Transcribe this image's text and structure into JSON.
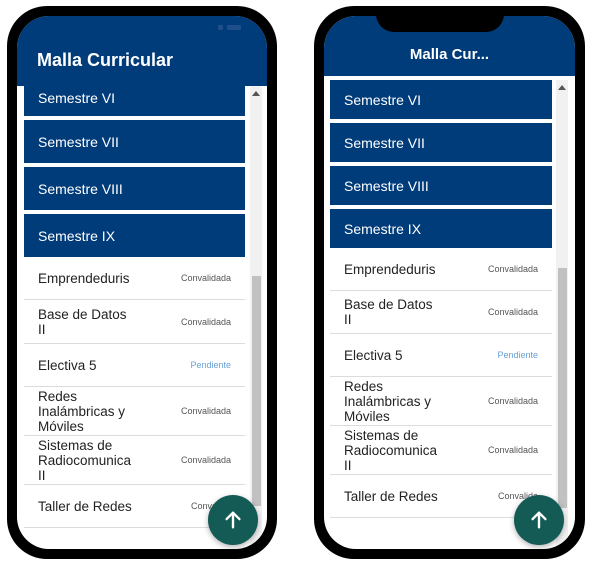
{
  "app": {
    "title_full": "Malla Curricular",
    "title_truncated": "Malla Cur..."
  },
  "semesters": [
    "Semestre VI",
    "Semestre VII",
    "Semestre VIII",
    "Semestre IX"
  ],
  "courses": [
    {
      "name": "Emprendeduris",
      "state": "Convalidada",
      "pending": false
    },
    {
      "name": "Base de Datos II",
      "state": "Convalidada",
      "pending": false
    },
    {
      "name": "Electiva 5",
      "state": "Pendiente",
      "pending": true
    },
    {
      "name": "Redes Inalámbricas y Móviles",
      "state": "Convalidada",
      "pending": false
    },
    {
      "name": "Sistemas de Radiocomunica II",
      "state": "Convalidada",
      "pending": false
    },
    {
      "name": "Taller de Redes",
      "state": "Convalida",
      "pending": false
    }
  ],
  "fab": {
    "icon": "arrow-up-icon"
  },
  "colors": {
    "primary": "#003b7a",
    "fab": "#145a55",
    "pending": "#6aa0d8"
  }
}
